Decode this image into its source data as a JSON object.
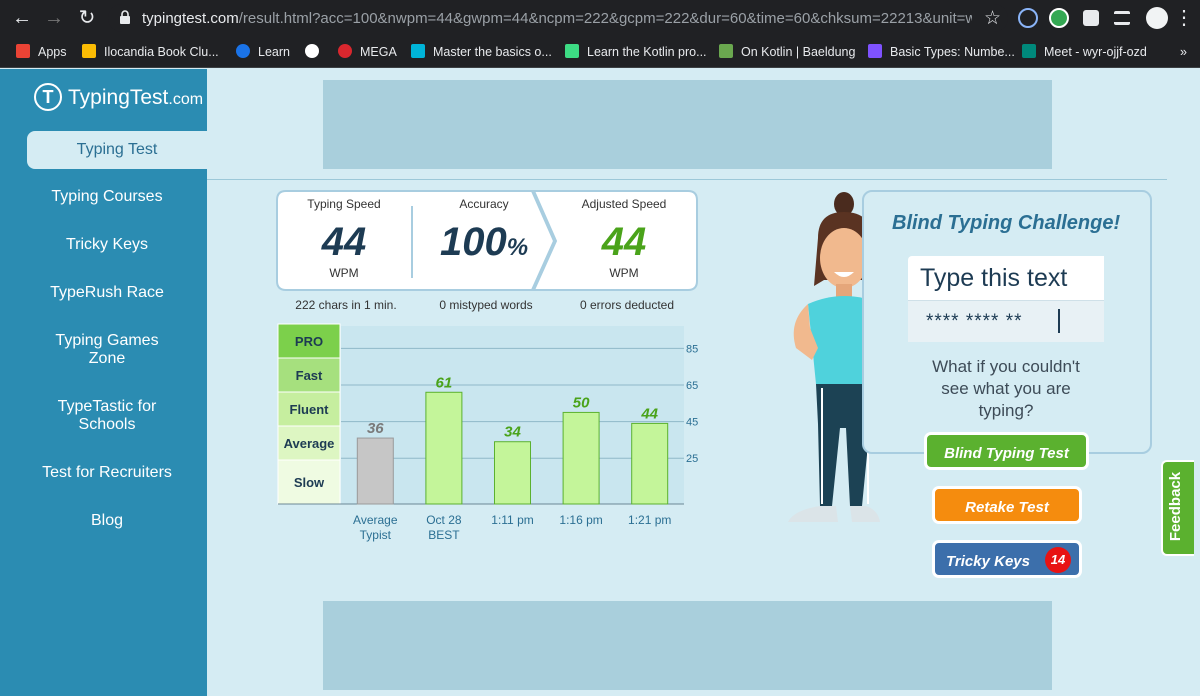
{
  "browser": {
    "url_host": "typingtest.com",
    "url_rest": "/result.html?acc=100&nwpm=44&gwpm=44&ncpm=222&gcpm=222&dur=60&time=60&chksum=22213&unit=w...",
    "bookmarks": [
      {
        "label": "Apps",
        "color": "#ea4335"
      },
      {
        "label": "Ilocandia Book Clu...",
        "color": "#fbbc04"
      },
      {
        "label": "Learn",
        "color": "#1a73e8"
      },
      {
        "label": "",
        "color": "#ffffff"
      },
      {
        "label": "MEGA",
        "color": "#d9272e"
      },
      {
        "label": "Master the basics o...",
        "color": "#00b4d8"
      },
      {
        "label": "Learn the Kotlin pro...",
        "color": "#3ddc84"
      },
      {
        "label": "On Kotlin | Baeldung",
        "color": "#6aa84f"
      },
      {
        "label": "Basic Types: Numbe...",
        "color": "#7f52ff"
      },
      {
        "label": "Meet - wyr-ojjf-ozd",
        "color": "#00897b"
      }
    ]
  },
  "site": {
    "logo": "TypingTest",
    "logo_suffix": ".com",
    "nav": [
      {
        "label": "Typing Test",
        "active": true
      },
      {
        "label": "Typing Courses"
      },
      {
        "label": "Tricky Keys"
      },
      {
        "label": "TypeRush Race"
      },
      {
        "label": "Typing Games Zone"
      },
      {
        "label": "TypeTastic for Schools"
      },
      {
        "label": "Test for Recruiters"
      },
      {
        "label": "Blog"
      }
    ]
  },
  "results": {
    "speed_label": "Typing Speed",
    "speed_value": "44",
    "speed_unit": "WPM",
    "accuracy_label": "Accuracy",
    "accuracy_value": "100",
    "accuracy_unit": "%",
    "adjusted_label": "Adjusted Speed",
    "adjusted_value": "44",
    "adjusted_unit": "WPM",
    "chars_note": "222 chars in 1 min.",
    "mistyped_note": "0 mistyped words",
    "errors_note": "0 errors deducted"
  },
  "chart_data": {
    "type": "bar",
    "levels": [
      "PRO",
      "Fast",
      "Fluent",
      "Average",
      "Slow"
    ],
    "categories": [
      "Average\nTypist",
      "Oct 28\nBEST",
      "1:11 pm",
      "1:16 pm",
      "1:21 pm"
    ],
    "values": [
      36,
      61,
      34,
      50,
      44
    ],
    "yticks": [
      25,
      45,
      65,
      85
    ],
    "ylim": [
      0,
      95
    ],
    "colors": {
      "baseline": "#c6c6c6",
      "result": "#c4f59a",
      "label_base": "#7a7a7a",
      "label_result": "#4aa31a"
    }
  },
  "challenge": {
    "title": "Blind Typing Challenge!",
    "prompt": "Type this text",
    "typed": "**** **** **",
    "question": "What if you couldn't see what you are typing?",
    "blind_button": "Blind Typing Test",
    "retake_button": "Retake Test",
    "tricky_button": "Tricky Keys",
    "tricky_badge": "14"
  },
  "feedback": "Feedback"
}
